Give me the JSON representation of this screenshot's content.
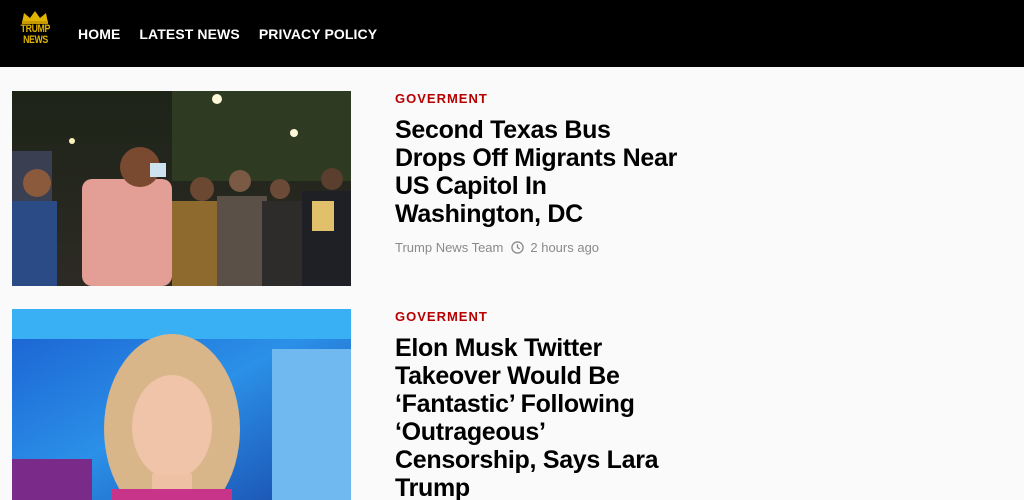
{
  "header": {
    "logo_text_1": "TRUMP",
    "logo_text_2": "NEWS",
    "nav": [
      "HOME",
      "LATEST NEWS",
      "PRIVACY POLICY"
    ]
  },
  "posts": [
    {
      "category": "GOVERMENT",
      "title": "Second Texas Bus Drops Off Migrants Near US Capitol In Washington, DC",
      "author": "Trump News Team",
      "time": "2 hours ago"
    },
    {
      "category": "GOVERMENT",
      "title": "Elon Musk Twitter Takeover Would Be ‘Fantastic’ Following ‘Outrageous’ Censorship, Says Lara Trump"
    }
  ],
  "colors": {
    "header_bg": "#000000",
    "category": "#b70000",
    "logo_gold": "#e0b400"
  }
}
